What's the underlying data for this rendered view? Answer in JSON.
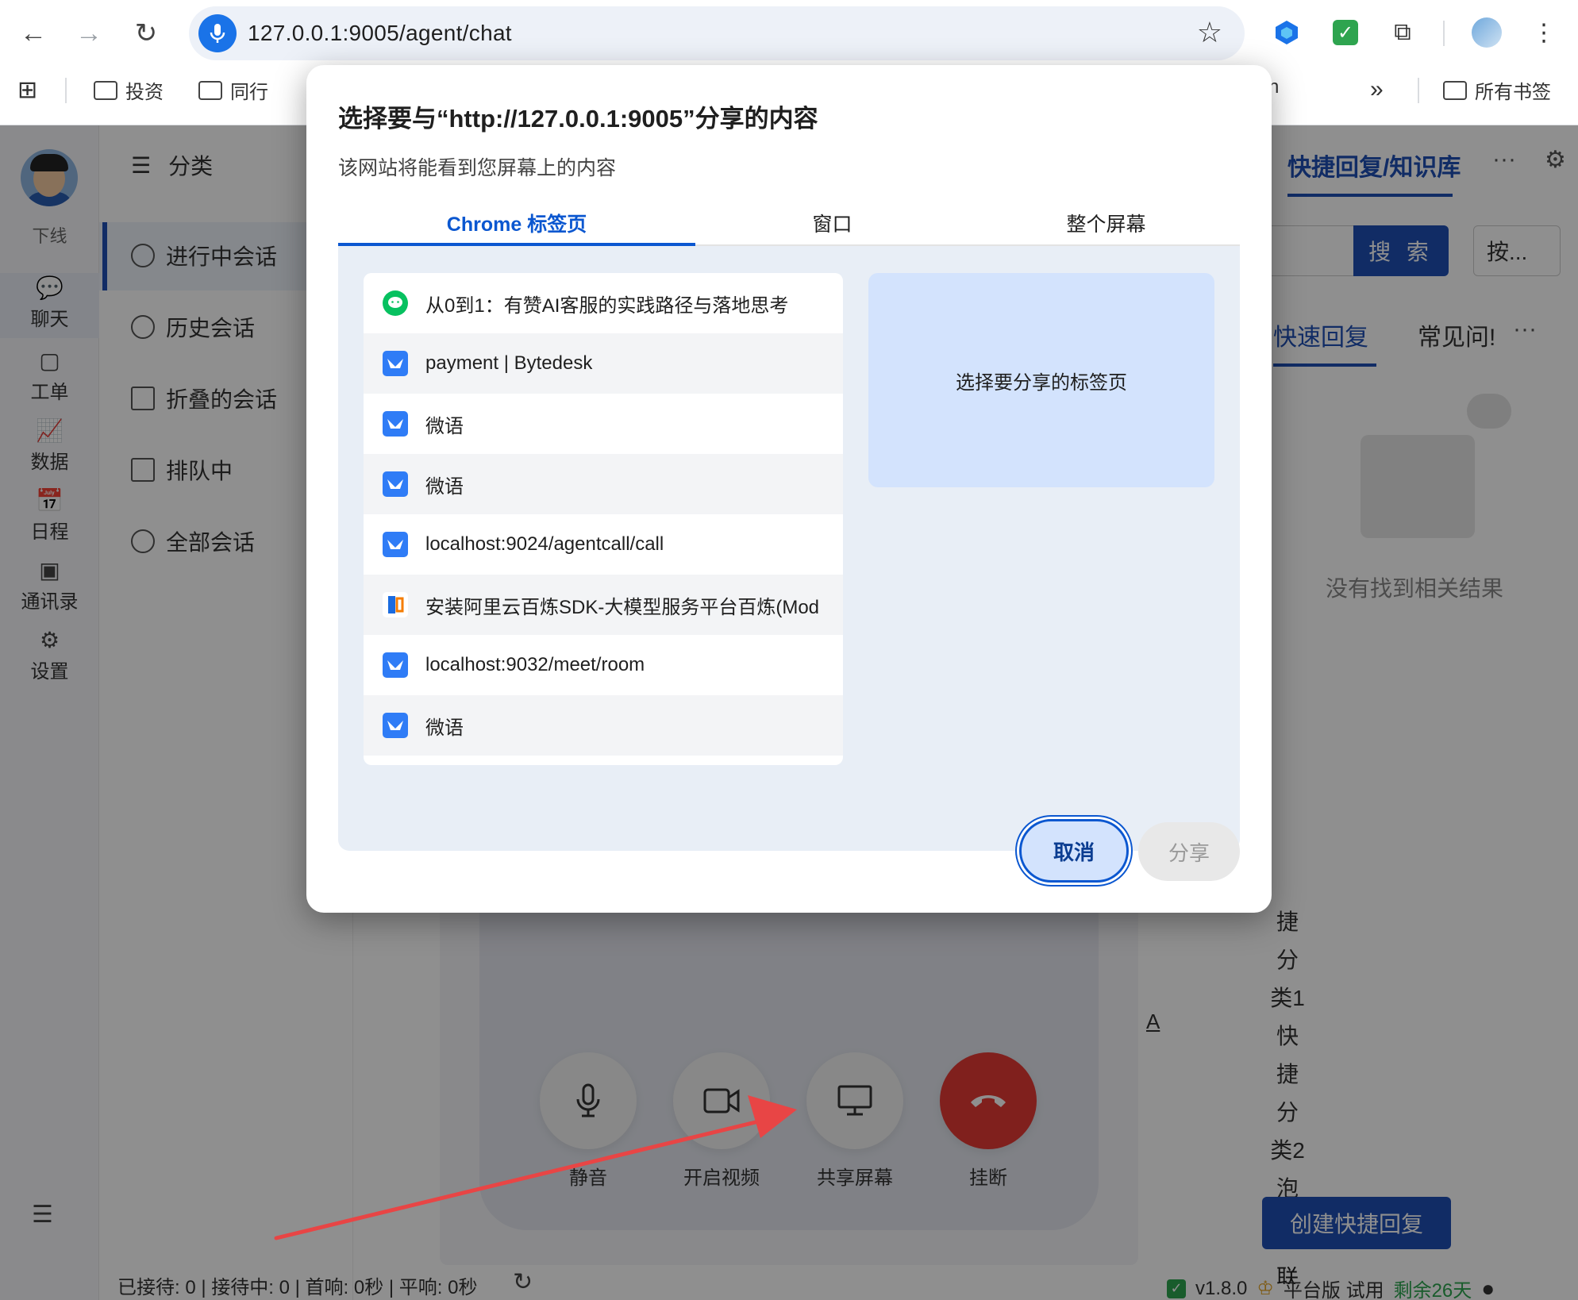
{
  "browser": {
    "url": "127.0.0.1:9005/agent/chat",
    "bookmarks": [
      {
        "label": "投资"
      },
      {
        "label": "同行"
      }
    ],
    "partial_bookmark": "n",
    "overflow": "»",
    "all_bookmarks": "所有书签"
  },
  "app": {
    "rail": {
      "status": "下线",
      "items": [
        {
          "label": "聊天",
          "icon": "chat-icon"
        },
        {
          "label": "工单",
          "icon": "ticket-icon"
        },
        {
          "label": "数据",
          "icon": "chart-icon"
        },
        {
          "label": "日程",
          "icon": "calendar-icon"
        },
        {
          "label": "通讯录",
          "icon": "contacts-icon"
        },
        {
          "label": "设置",
          "icon": "settings-icon"
        }
      ]
    },
    "conversations": {
      "header": "分类",
      "items": [
        {
          "label": "进行中会话"
        },
        {
          "label": "历史会话"
        },
        {
          "label": "折叠的会话"
        },
        {
          "label": "排队中"
        },
        {
          "label": "全部会话"
        }
      ]
    },
    "right_panel": {
      "tab": "快捷回复/知识库",
      "more": "···",
      "search_button": "搜 索",
      "select_value": "按...",
      "subtabs": [
        "快速回复",
        "常见问!"
      ],
      "empty_text": "没有找到相关结果",
      "vertical_lines": [
        "捷",
        "分",
        "类1",
        "快",
        "捷",
        "分",
        "类2",
        "泡"
      ],
      "create_button": "创建快捷回复",
      "bottom_cut": "联"
    },
    "call": {
      "mute": "静音",
      "video": "开启视频",
      "share_screen": "共享屏幕",
      "hangup": "挂断"
    },
    "a_mark": "A",
    "status_text": "已接待: 0 | 接待中: 0 | 首响: 0秒 | 平响: 0秒",
    "version": "v1.8.0",
    "plan": "平台版 试用",
    "remaining": "剩余26天"
  },
  "dialog": {
    "title": "选择要与“http://127.0.0.1:9005”分享的内容",
    "subtitle": "该网站将能看到您屏幕上的内容",
    "tabs": [
      "Chrome 标签页",
      "窗口",
      "整个屏幕"
    ],
    "active_tab": "Chrome 标签页",
    "tab_items": [
      {
        "title": "从0到1：有赞AI客服的实践路径与落地思考",
        "icon": "wechat-icon"
      },
      {
        "title": "payment | Bytedesk",
        "icon": "weiyu-icon"
      },
      {
        "title": "微语",
        "icon": "weiyu-icon"
      },
      {
        "title": "微语",
        "icon": "weiyu-icon"
      },
      {
        "title": "localhost:9024/agentcall/call",
        "icon": "weiyu-icon"
      },
      {
        "title": "安装阿里云百炼SDK-大模型服务平台百炼(Mod",
        "icon": "aliyun-icon"
      },
      {
        "title": "localhost:9032/meet/room",
        "icon": "weiyu-icon"
      },
      {
        "title": "微语",
        "icon": "weiyu-icon"
      }
    ],
    "preview_text": "选择要分享的标签页",
    "cancel": "取消",
    "share": "分享"
  }
}
